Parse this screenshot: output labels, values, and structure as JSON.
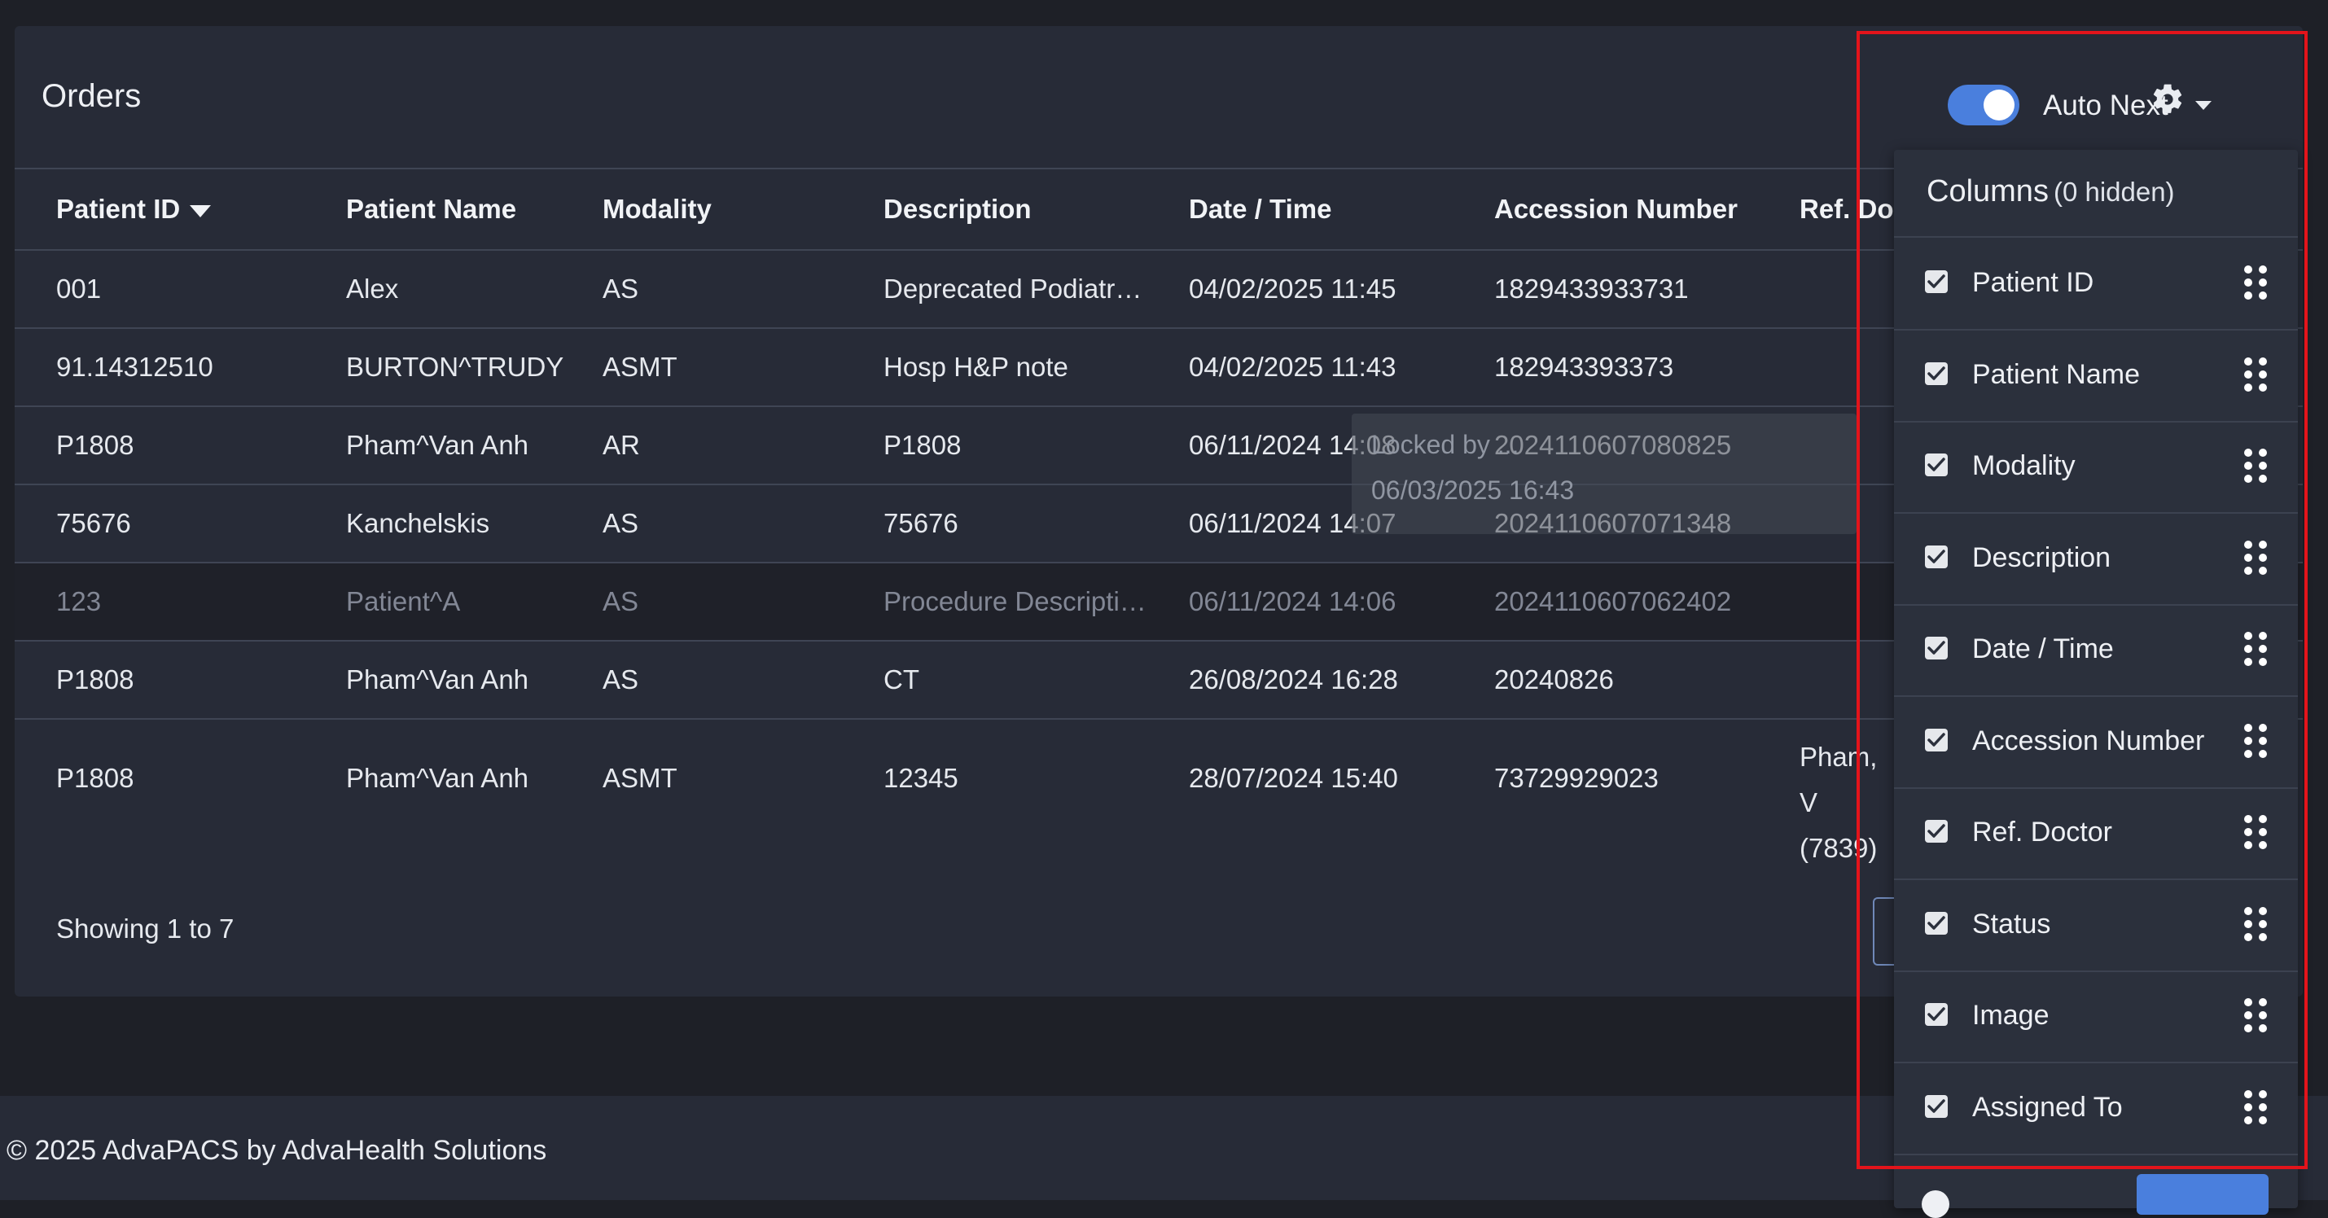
{
  "page": {
    "title": "Orders",
    "auto_next_label": "Auto Next",
    "auto_next_on": true,
    "showing": "Showing 1 to 7",
    "footer": "© 2025 AdvaPACS by AdvaHealth Solutions"
  },
  "table": {
    "headers": [
      "Patient ID",
      "Patient Name",
      "Modality",
      "Description",
      "Date / Time",
      "Accession Number",
      "Ref. Do"
    ],
    "sort_column": "Patient ID",
    "sort_direction": "descending",
    "rows": [
      {
        "patient_id": "001",
        "patient_name": "Alex",
        "modality": "AS",
        "description": "Deprecated Podiatr…",
        "date_time": "04/02/2025 11:45",
        "accession": "1829433933731",
        "ref_doctor": "",
        "ref_doctor_2": "",
        "locked": false
      },
      {
        "patient_id": "91.14312510",
        "patient_name": "BURTON^TRUDY",
        "modality": "ASMT",
        "description": "Hosp H&P note",
        "date_time": "04/02/2025 11:43",
        "accession": "182943393373",
        "ref_doctor": "",
        "ref_doctor_2": "",
        "locked": false
      },
      {
        "patient_id": "P1808",
        "patient_name": "Pham^Van Anh",
        "modality": "AR",
        "description": "P1808",
        "date_time": "06/11/2024 14:08",
        "accession": "2024110607080825",
        "ref_doctor": "",
        "ref_doctor_2": "",
        "locked": false
      },
      {
        "patient_id": "75676",
        "patient_name": "Kanchelskis",
        "modality": "AS",
        "description": "75676",
        "date_time": "06/11/2024 14:07",
        "accession": "2024110607071348",
        "ref_doctor": "",
        "ref_doctor_2": "",
        "locked": false
      },
      {
        "patient_id": "123",
        "patient_name": "Patient^A",
        "modality": "AS",
        "description": "Procedure Descripti…",
        "date_time": "06/11/2024 14:06",
        "accession": "2024110607062402",
        "ref_doctor": "",
        "ref_doctor_2": "",
        "locked": true
      },
      {
        "patient_id": "P1808",
        "patient_name": "Pham^Van Anh",
        "modality": "AS",
        "description": "CT",
        "date_time": "26/08/2024 16:28",
        "accession": "20240826",
        "ref_doctor": "",
        "ref_doctor_2": "",
        "locked": false
      },
      {
        "patient_id": "P1808",
        "patient_name": "Pham^Van Anh",
        "modality": "ASMT",
        "description": "12345",
        "date_time": "28/07/2024 15:40",
        "accession": "73729929023",
        "ref_doctor": "Pham, V",
        "ref_doctor_2": "(7839)",
        "locked": false
      }
    ]
  },
  "tooltip": {
    "line1": "Locked by ...",
    "line2": "06/03/2025 16:43"
  },
  "columns_panel": {
    "title": "Columns",
    "hidden_note": "(0 hidden)",
    "items": [
      {
        "label": "Patient ID",
        "checked": true
      },
      {
        "label": "Patient Name",
        "checked": true
      },
      {
        "label": "Modality",
        "checked": true
      },
      {
        "label": "Description",
        "checked": true
      },
      {
        "label": "Date / Time",
        "checked": true
      },
      {
        "label": "Accession Number",
        "checked": true
      },
      {
        "label": "Ref. Doctor",
        "checked": true
      },
      {
        "label": "Status",
        "checked": true
      },
      {
        "label": "Image",
        "checked": true
      },
      {
        "label": "Assigned To",
        "checked": true
      }
    ]
  },
  "colors": {
    "background": "#1e2027",
    "card": "#272b37",
    "accent": "#4a7fdd",
    "highlight": "#e3141b"
  },
  "icons": [
    "gear-icon",
    "chevron-down-icon",
    "sort-desc-icon",
    "checkbox-checked-icon",
    "drag-grip-icon"
  ]
}
